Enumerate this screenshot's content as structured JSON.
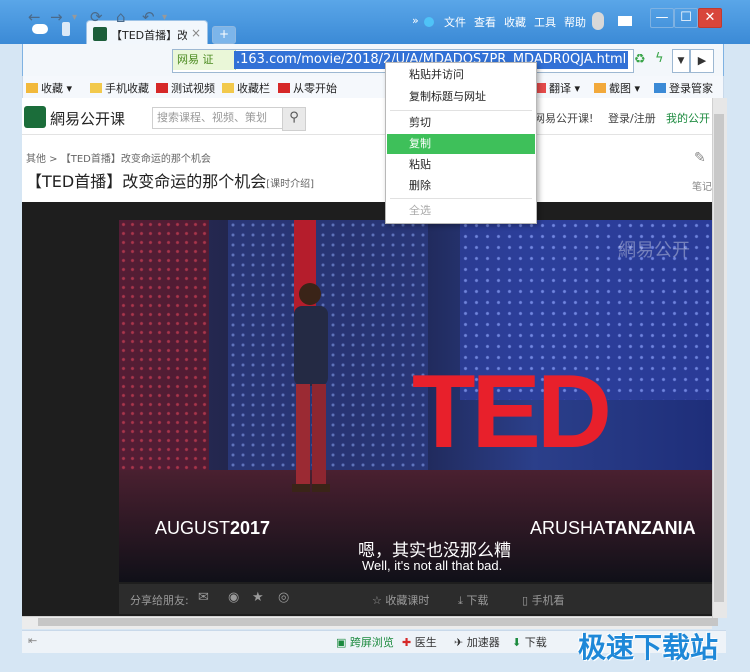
{
  "titlebar": {
    "tab_title": "【TED首播】改",
    "new_tab": "+",
    "menus": [
      "文件",
      "查看",
      "收藏",
      "工具",
      "帮助"
    ],
    "window_controls": {
      "minimize": "—",
      "maximize": "☐",
      "close": "✕"
    }
  },
  "address": {
    "security_label": "网易 证",
    "url": ".163.com/movie/2018/2/U/A/MDADQS7PR_MDADR0QJA.html"
  },
  "bookmarks": [
    "收藏",
    "手机收藏",
    "测试视频",
    "收藏栏",
    "从零开始",
    "翻译",
    "截图",
    "登录管家"
  ],
  "site": {
    "logo_text": "網易公开课",
    "search_placeholder": "搜索课程、视频、策划",
    "header_right": [
      "网易公开课!",
      "登录/注册",
      "我的公开"
    ],
    "breadcrumb": "其他 > 【TED首播】改变命运的那个机会",
    "title": "【TED首播】改变命运的那个机会",
    "title_suffix": "[课时介绍]",
    "note_label": "笔记"
  },
  "video": {
    "watermark": "網易公开",
    "big_text": "TED",
    "caption_date_a": "AUGUST",
    "caption_date_b": "2017",
    "caption_loc_a": "ARUSHA",
    "caption_loc_b": "TANZANIA",
    "subtitle_cn": "嗯，其实也没那么糟",
    "subtitle_en": "Well, it's not all that bad."
  },
  "sharebar": {
    "share_label": "分享给朋友:",
    "collect": "收藏课时",
    "download": "下载",
    "mobile": "手机看"
  },
  "statusbar": [
    "跨屏浏览",
    "医生",
    "加速器",
    "下载"
  ],
  "context_menu": {
    "items": [
      {
        "label": "粘贴并访问",
        "state": "normal"
      },
      {
        "label": "复制标题与网址",
        "state": "normal"
      },
      {
        "label": "剪切",
        "state": "normal"
      },
      {
        "label": "复制",
        "state": "highlight"
      },
      {
        "label": "粘贴",
        "state": "normal"
      },
      {
        "label": "删除",
        "state": "normal"
      },
      {
        "label": "全选",
        "state": "disabled"
      }
    ]
  },
  "corner_watermark": "极速下载站",
  "colors": {
    "accent": "#3b8ad6",
    "menu_highlight": "#3ec05a",
    "ted_red": "#e8202b"
  }
}
